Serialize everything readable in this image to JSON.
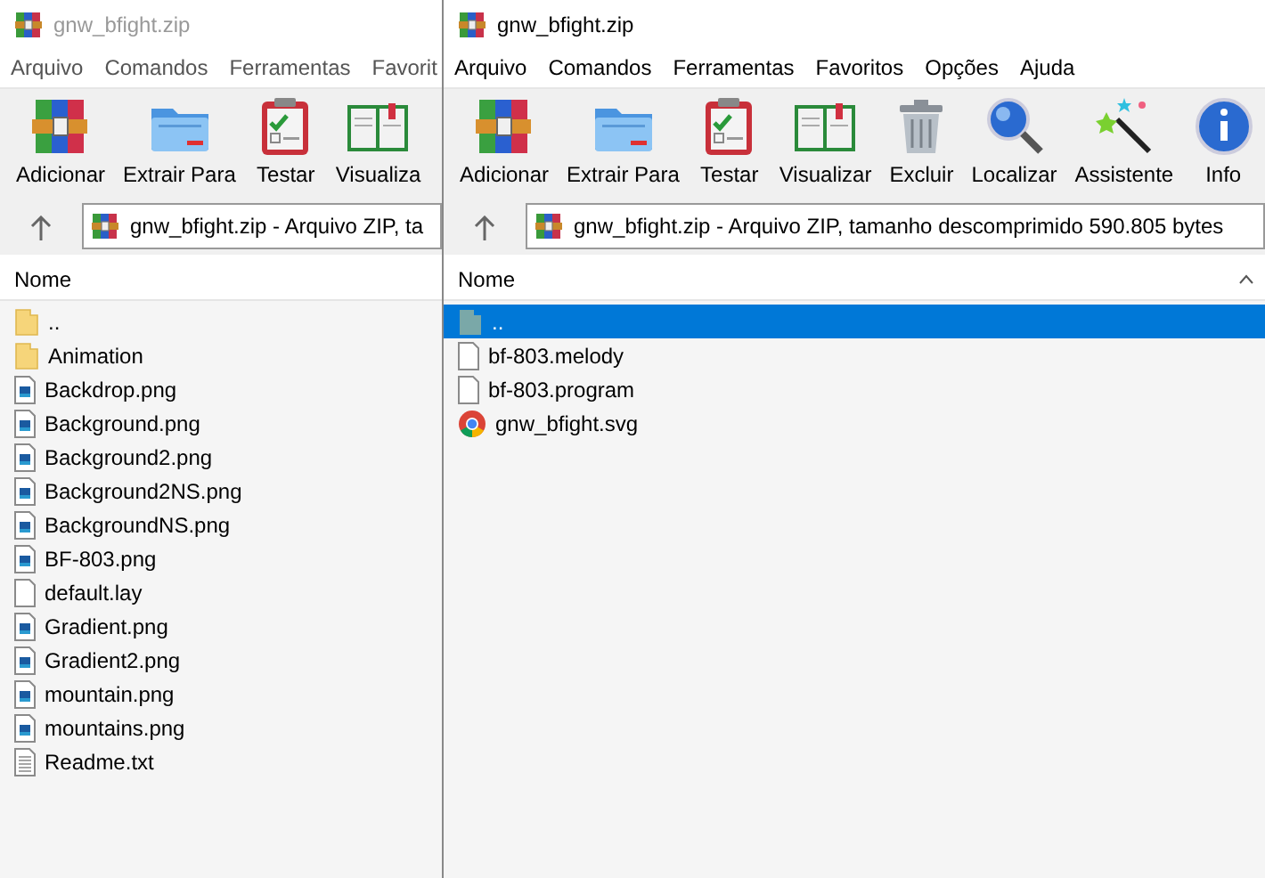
{
  "windows": [
    {
      "title": "gnw_bfight.zip",
      "active": false,
      "menu": [
        "Arquivo",
        "Comandos",
        "Ferramentas",
        "Favorit"
      ],
      "toolbar": [
        {
          "label": "Adicionar",
          "kind": "add"
        },
        {
          "label": "Extrair Para",
          "kind": "extract"
        },
        {
          "label": "Testar",
          "kind": "test"
        },
        {
          "label": "Visualiza",
          "kind": "view"
        }
      ],
      "address": "gnw_bfight.zip - Arquivo ZIP, ta",
      "column": "Nome",
      "rows": [
        {
          "name": "..",
          "kind": "folder",
          "selected": false
        },
        {
          "name": "Animation",
          "kind": "folder",
          "selected": false
        },
        {
          "name": "Backdrop.png",
          "kind": "image",
          "selected": false
        },
        {
          "name": "Background.png",
          "kind": "image",
          "selected": false
        },
        {
          "name": "Background2.png",
          "kind": "image",
          "selected": false
        },
        {
          "name": "Background2NS.png",
          "kind": "image",
          "selected": false
        },
        {
          "name": "BackgroundNS.png",
          "kind": "image",
          "selected": false
        },
        {
          "name": "BF-803.png",
          "kind": "image",
          "selected": false
        },
        {
          "name": "default.lay",
          "kind": "file",
          "selected": false
        },
        {
          "name": "Gradient.png",
          "kind": "image",
          "selected": false
        },
        {
          "name": "Gradient2.png",
          "kind": "image",
          "selected": false
        },
        {
          "name": "mountain.png",
          "kind": "image",
          "selected": false
        },
        {
          "name": "mountains.png",
          "kind": "image",
          "selected": false
        },
        {
          "name": "Readme.txt",
          "kind": "text",
          "selected": false
        }
      ]
    },
    {
      "title": "gnw_bfight.zip",
      "active": true,
      "menu": [
        "Arquivo",
        "Comandos",
        "Ferramentas",
        "Favoritos",
        "Opções",
        "Ajuda"
      ],
      "toolbar": [
        {
          "label": "Adicionar",
          "kind": "add"
        },
        {
          "label": "Extrair Para",
          "kind": "extract"
        },
        {
          "label": "Testar",
          "kind": "test"
        },
        {
          "label": "Visualizar",
          "kind": "view"
        },
        {
          "label": "Excluir",
          "kind": "delete"
        },
        {
          "label": "Localizar",
          "kind": "find"
        },
        {
          "label": "Assistente",
          "kind": "wizard"
        },
        {
          "label": "Info",
          "kind": "info"
        }
      ],
      "address": "gnw_bfight.zip - Arquivo ZIP, tamanho descomprimido 590.805 bytes",
      "column": "Nome",
      "rows": [
        {
          "name": "..",
          "kind": "up",
          "selected": true
        },
        {
          "name": "bf-803.melody",
          "kind": "file",
          "selected": false
        },
        {
          "name": "bf-803.program",
          "kind": "file",
          "selected": false
        },
        {
          "name": "gnw_bfight.svg",
          "kind": "browser",
          "selected": false
        }
      ]
    }
  ]
}
